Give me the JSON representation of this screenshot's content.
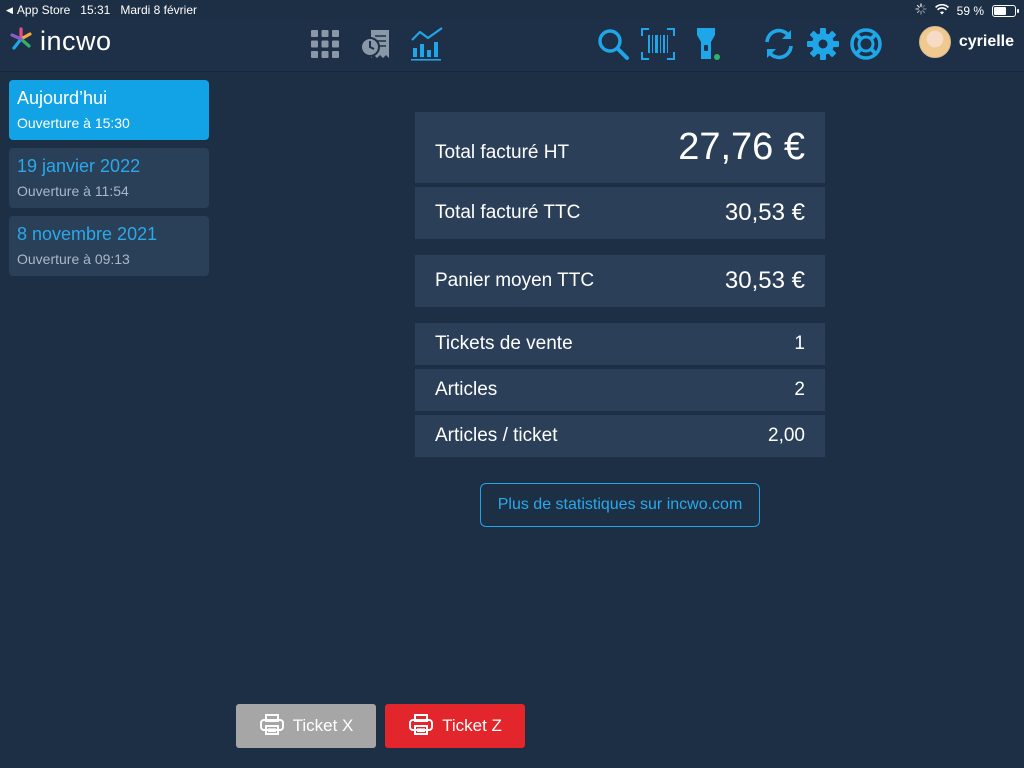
{
  "status_bar": {
    "back_app": "App Store",
    "time": "15:31",
    "date": "Mardi 8 février",
    "battery": "59 %",
    "battery_level": 0.59
  },
  "nav": {
    "logo": "incwo",
    "user_name": "cyrielle",
    "icons": [
      "grid-icon",
      "receipt-clock-icon",
      "stats-chart-icon",
      "search-icon",
      "barcode-scan-icon",
      "flashlight-icon",
      "sync-icon",
      "gear-icon",
      "help-lifebuoy-icon"
    ],
    "accent": "#1fa6e8"
  },
  "sidebar": {
    "items": [
      {
        "title": "Aujourd’hui",
        "subtitle": "Ouverture à 15:30",
        "active": true
      },
      {
        "title": "19 janvier 2022",
        "subtitle": "Ouverture à 11:54",
        "active": false
      },
      {
        "title": "8 novembre 2021",
        "subtitle": "Ouverture à 09:13",
        "active": false
      }
    ]
  },
  "stats": {
    "total_ht": {
      "label": "Total facturé HT",
      "value": "27,76 €"
    },
    "total_ttc": {
      "label": "Total facturé TTC",
      "value": "30,53 €"
    },
    "panier": {
      "label": "Panier moyen TTC",
      "value": "30,53 €"
    },
    "tickets": {
      "label": "Tickets de vente",
      "value": "1"
    },
    "articles": {
      "label": "Articles",
      "value": "2"
    },
    "articles_ticket": {
      "label": "Articles / ticket",
      "value": "2,00"
    }
  },
  "more_stats_label": "Plus de statistiques sur incwo.com",
  "buttons": {
    "ticket_x": "Ticket X",
    "ticket_z": "Ticket Z"
  },
  "colors": {
    "background": "#1d2f45",
    "card": "#2b4058",
    "active": "#12a2e6",
    "ticket_x": "#a6a6a6",
    "ticket_z": "#e3262b"
  }
}
